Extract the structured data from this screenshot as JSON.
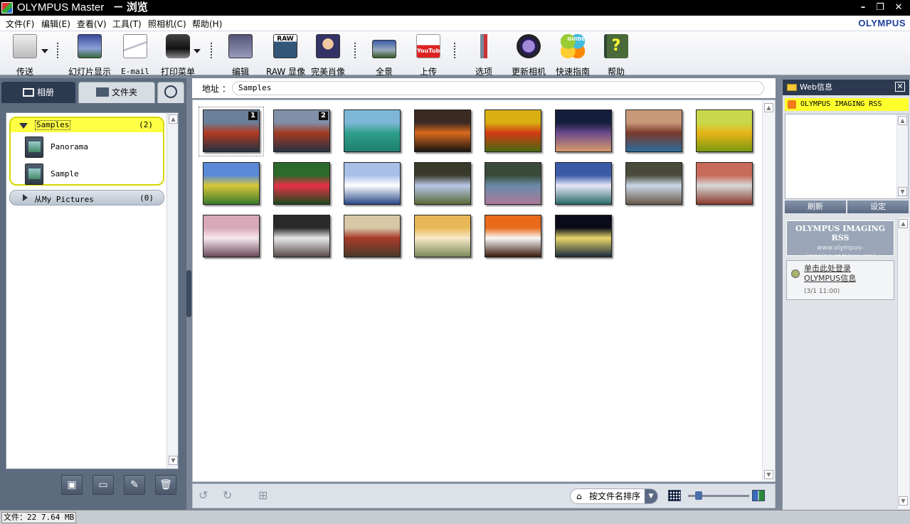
{
  "titlebar": {
    "app_name": "OLYMPUS Master",
    "window_title": "－ 浏览"
  },
  "menu": [
    "文件(F)",
    "编辑(E)",
    "查看(V)",
    "工具(T)",
    "照相机(C)",
    "帮助(H)"
  ],
  "brand": "OLYMPUS",
  "toolbar": {
    "transfer": "传送",
    "slideshow": "幻灯片显示",
    "email": "E-mail",
    "print": "打印菜单",
    "edit": "编辑",
    "raw": "RAW 显像",
    "portrait": "完美肖像",
    "panorama": "全景",
    "upload": "上传",
    "options": "选项",
    "update": "更新相机",
    "guide": "快速指南",
    "help": "帮助",
    "raw_badge": "RAW",
    "youtube_badge": "YouTube",
    "guide_badge": "GUIDE"
  },
  "left": {
    "tab_album": "相册",
    "tab_folder": "文件夹",
    "albums": {
      "samples": "Samples",
      "samples_count": "(2)",
      "panorama": "Panorama",
      "sample": "Sample",
      "mypics": "从My Pictures",
      "mypics_count": "(0)"
    }
  },
  "address": {
    "label": "地址 ：",
    "value": "Samples"
  },
  "thumbnails": [
    {
      "badge": "1",
      "colors": [
        "#6a7f9a",
        "#b33a20",
        "#263140"
      ]
    },
    {
      "badge": "2",
      "colors": [
        "#8090a8",
        "#a33b22",
        "#2a3242"
      ]
    },
    {
      "badge": "",
      "colors": [
        "#7fb7d9",
        "#2f9f8a",
        "#1e7f70"
      ]
    },
    {
      "badge": "",
      "colors": [
        "#3a2a22",
        "#d96a1c",
        "#1a1410"
      ]
    },
    {
      "badge": "",
      "colors": [
        "#d8b010",
        "#d23a14",
        "#4a6a10"
      ]
    },
    {
      "badge": "",
      "colors": [
        "#141e3c",
        "#6a4a8c",
        "#d89a6a"
      ]
    },
    {
      "badge": "",
      "colors": [
        "#c89878",
        "#7a3a2a",
        "#2a6a9a"
      ]
    },
    {
      "badge": "",
      "colors": [
        "#c8d84a",
        "#e8b418",
        "#7a9a10"
      ]
    },
    {
      "badge": "",
      "colors": [
        "#5a8ad8",
        "#d8c83a",
        "#3a7a2a"
      ]
    },
    {
      "badge": "",
      "colors": [
        "#2a6a2a",
        "#e8304a",
        "#1a4a1a"
      ]
    },
    {
      "badge": "",
      "colors": [
        "#a8c0e8",
        "#ffffff",
        "#2a4a8a"
      ]
    },
    {
      "badge": "",
      "colors": [
        "#3a3a2a",
        "#b8c8e8",
        "#5a6a3a"
      ]
    },
    {
      "badge": "",
      "colors": [
        "#3a4a3a",
        "#6a8aa8",
        "#aa7a9a"
      ]
    },
    {
      "badge": "",
      "colors": [
        "#3a5aa8",
        "#e8e8f8",
        "#2a6a6a"
      ]
    },
    {
      "badge": "",
      "colors": [
        "#4a4a3a",
        "#c8d8e8",
        "#6a5a4a"
      ]
    },
    {
      "badge": "",
      "colors": [
        "#c86a5a",
        "#d8d8d8",
        "#8a3a2a"
      ]
    },
    {
      "badge": "",
      "colors": [
        "#d8a8b8",
        "#f8e8f0",
        "#6a4a5a"
      ]
    },
    {
      "badge": "",
      "colors": [
        "#2a2a2a",
        "#e8e8e8",
        "#5a4a4a"
      ]
    },
    {
      "badge": "",
      "colors": [
        "#d8c8a8",
        "#a83a2a",
        "#4a3a2a"
      ]
    },
    {
      "badge": "",
      "colors": [
        "#e8b858",
        "#f8e8c8",
        "#7a8a5a"
      ]
    },
    {
      "badge": "",
      "colors": [
        "#e86a1a",
        "#f8f8f8",
        "#3a1a0a"
      ]
    },
    {
      "badge": "",
      "colors": [
        "#0a0a1a",
        "#e8d86a",
        "#1a2a3a"
      ]
    }
  ],
  "bottom": {
    "sort_label": "按文件名排序"
  },
  "web": {
    "header": "Web信息",
    "rss_title": "OLYMPUS IMAGING RSS",
    "refresh": "刷新",
    "settings": "设定",
    "feed_title": "OLYMPUS IMAGING RSS",
    "feed_url": "www.olympus-imaging.com/ww_rss/",
    "item_line1": "单击此处登录",
    "item_line2": "OLYMPUS信息",
    "item_date": "(3/1 11:00)"
  },
  "status": {
    "text": "文件：22  7.64 MB"
  }
}
